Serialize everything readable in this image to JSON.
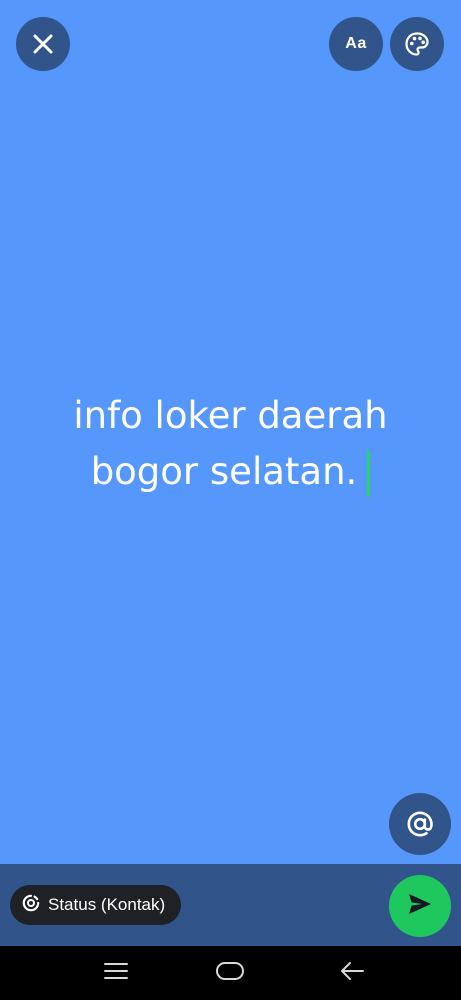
{
  "colors": {
    "background": "#5697fb",
    "button_bg": "#31548a",
    "send_button": "#1fc85f",
    "caret": "#25d366",
    "pill_bg": "#1f2124",
    "nav_bar": "#000000"
  },
  "toolbar": {
    "close_icon": "close-icon",
    "font_label": "Aa",
    "palette_icon": "palette-icon"
  },
  "status": {
    "line1": "info loker daerah",
    "line2": "bogor selatan."
  },
  "mention": {
    "icon": "at-icon"
  },
  "bottom": {
    "audience_icon": "status-ring-icon",
    "audience_label": "Status (Kontak)",
    "send_icon": "send-icon"
  },
  "navigation": {
    "menu_icon": "recent-apps-icon",
    "home_icon": "home-icon",
    "back_icon": "back-icon"
  }
}
